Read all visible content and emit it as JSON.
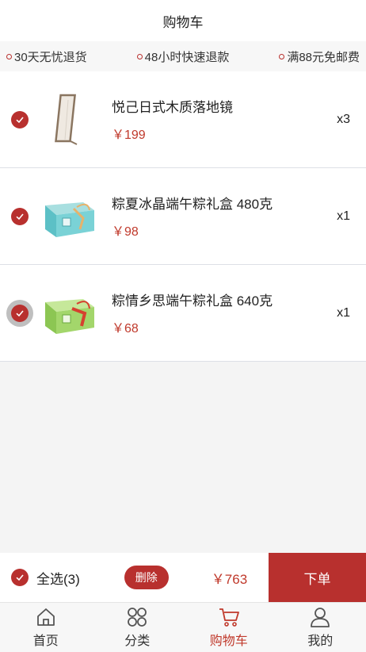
{
  "header": {
    "title": "购物车"
  },
  "promos": [
    {
      "text": "30天无忧退货"
    },
    {
      "text": "48小时快速退款"
    },
    {
      "text": "满88元免邮费"
    }
  ],
  "cart": {
    "items": [
      {
        "name": "悦己日式木质落地镜",
        "price": "￥199",
        "qty": "x3",
        "checked": true,
        "image": "mirror"
      },
      {
        "name": "粽夏冰晶端午粽礼盒 480克",
        "price": "￥98",
        "qty": "x1",
        "checked": true,
        "image": "teal-gift-box"
      },
      {
        "name": "粽情乡思端午粽礼盒 640克",
        "price": "￥68",
        "qty": "x1",
        "checked": true,
        "image": "green-gift-box"
      }
    ]
  },
  "bottom": {
    "select_all_label": "全选(3)",
    "delete_label": "删除",
    "total": "￥763",
    "order_label": "下单"
  },
  "tabs": [
    {
      "label": "首页",
      "icon": "home-icon",
      "active": false
    },
    {
      "label": "分类",
      "icon": "category-icon",
      "active": false
    },
    {
      "label": "购物车",
      "icon": "cart-icon",
      "active": true
    },
    {
      "label": "我的",
      "icon": "user-icon",
      "active": false
    }
  ],
  "colors": {
    "accent": "#b8302e",
    "price": "#c0392b"
  }
}
